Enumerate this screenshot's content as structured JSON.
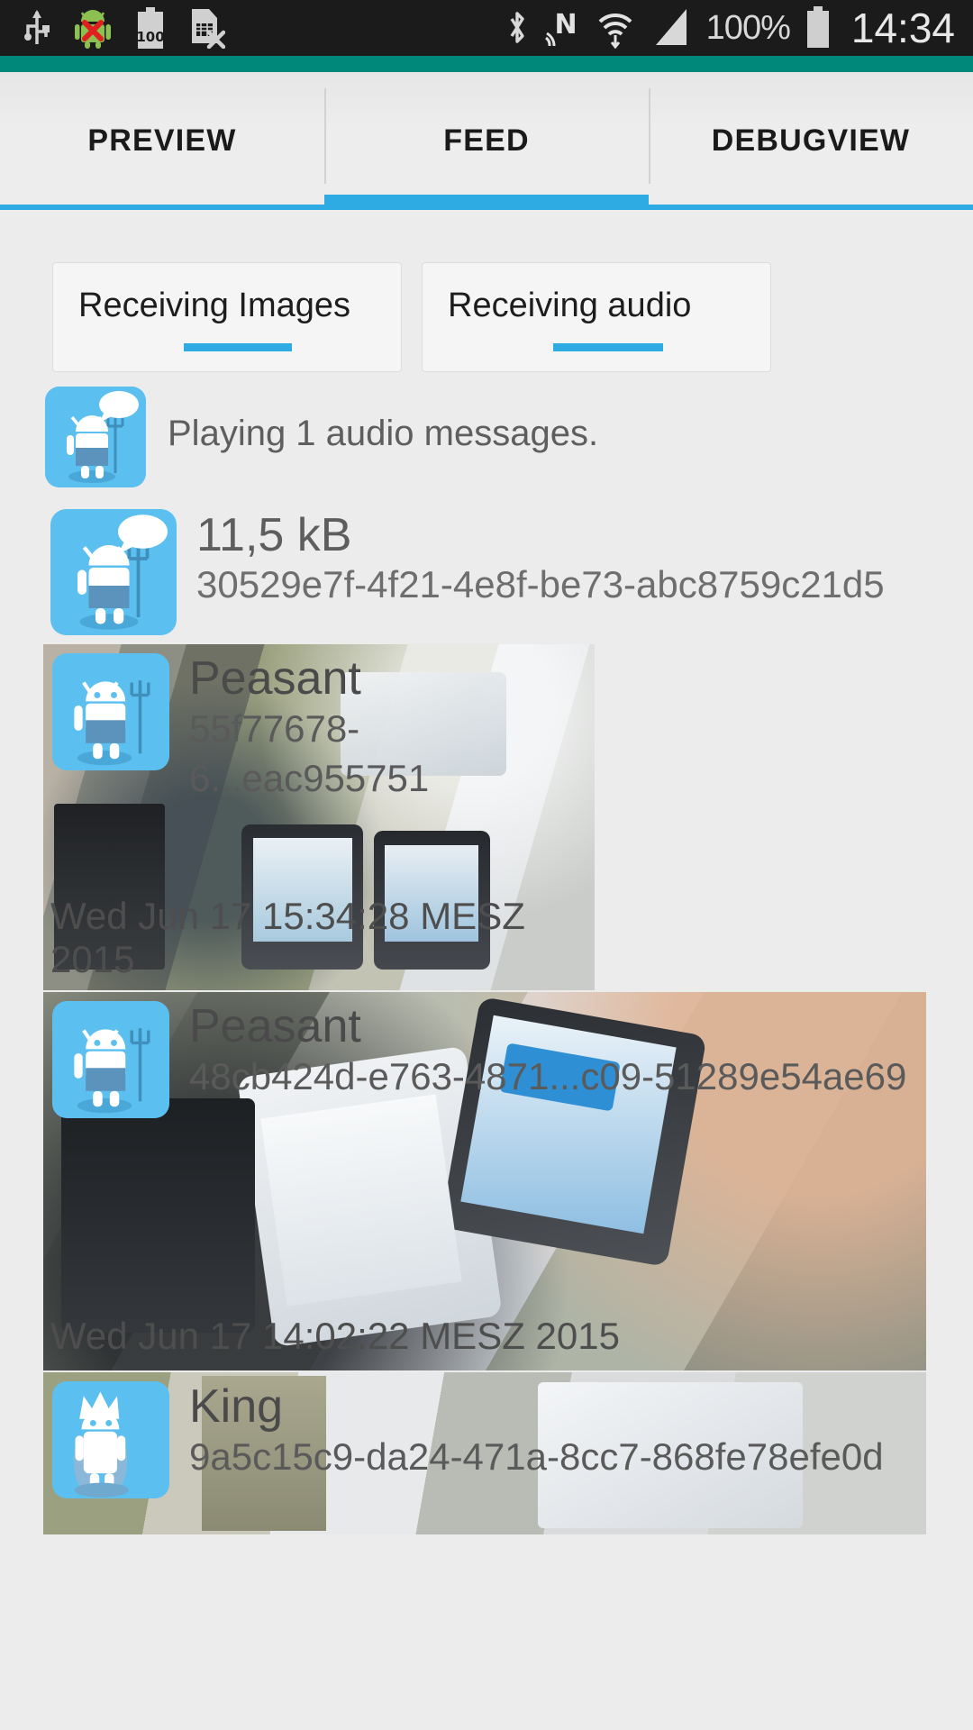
{
  "statusbar": {
    "icons": [
      "usb-icon",
      "android-error-icon",
      "battery-100-icon",
      "sim-card-error-icon",
      "bluetooth-icon",
      "nfc-icon",
      "wifi-icon",
      "cell-signal-icon"
    ],
    "battery_percent": "100%",
    "battery_icon": "battery-full-icon",
    "clock": "14:34"
  },
  "theme": {
    "accent_blue": "#2eabe2",
    "teal_bar": "#00897b",
    "avatar_blue": "#5bc0f0",
    "page_bg": "#ececec",
    "status_bg": "#1b1b1b"
  },
  "tabs": [
    {
      "label": "PREVIEW",
      "selected": false
    },
    {
      "label": "FEED",
      "selected": true
    },
    {
      "label": "DEBUGVIEW",
      "selected": false
    }
  ],
  "status_cards": [
    {
      "label": "Receiving Images",
      "progress_visible": true
    },
    {
      "label": "Receiving audio",
      "progress_visible": true
    }
  ],
  "feed": {
    "playing_notice": {
      "avatar": "peasant-speech-avatar",
      "text": "Playing 1 audio messages."
    },
    "audio_message": {
      "avatar": "peasant-speech-avatar",
      "size": "11,5 kB",
      "uuid": "30529e7f-4f21-4e8f-be73-abc8759c21d5"
    },
    "image_messages": [
      {
        "avatar": "peasant-avatar",
        "name": "Peasant",
        "uuid": "55f77678-6...eac955751",
        "timestamp": "Wed Jun 17 15:34:28 MESZ 2015"
      },
      {
        "avatar": "peasant-avatar",
        "name": "Peasant",
        "uuid": "48cb424d-e763-4871...c09-51289e54ae69",
        "timestamp": "Wed Jun 17 14:02:22 MESZ 2015"
      },
      {
        "avatar": "king-avatar",
        "name": "King",
        "uuid": "9a5c15c9-da24-471a-8cc7-868fe78efe0d",
        "timestamp": ""
      }
    ]
  }
}
